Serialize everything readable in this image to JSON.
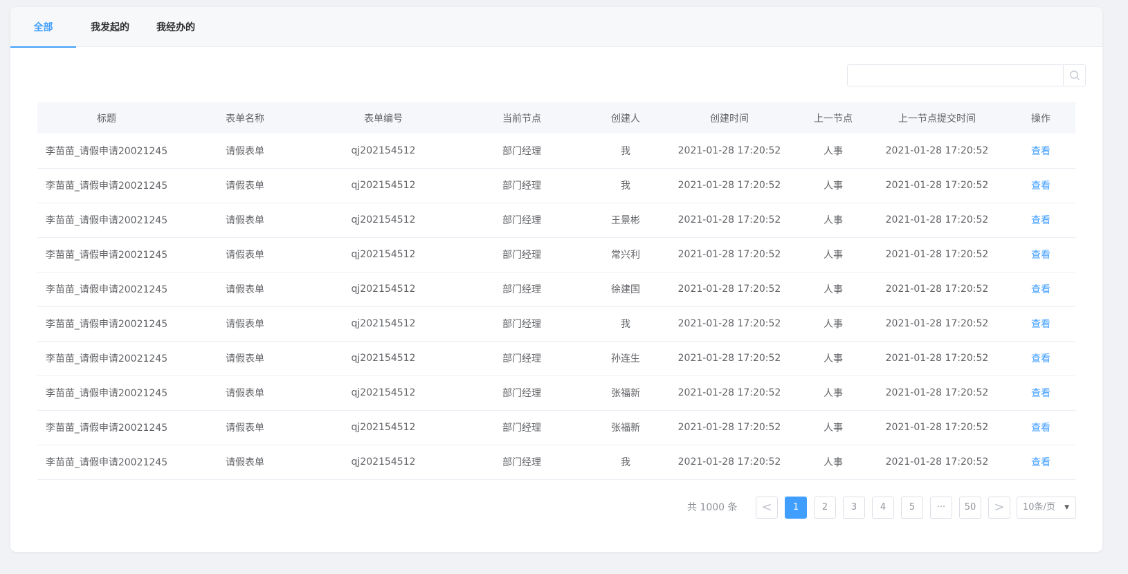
{
  "tabs": [
    {
      "label": "全部",
      "active": true
    },
    {
      "label": "我发起的",
      "active": false
    },
    {
      "label": "我经办的",
      "active": false
    }
  ],
  "search": {
    "placeholder": "",
    "value": "",
    "icon": "search-icon"
  },
  "table": {
    "columns": [
      "标题",
      "表单名称",
      "表单编号",
      "当前节点",
      "创建人",
      "创建时间",
      "上一节点",
      "上一节点提交时间",
      "操作"
    ],
    "rows": [
      {
        "title": "李苗苗_请假申请20021245",
        "form_name": "请假表单",
        "form_no": "qj202154512",
        "current_node": "部门经理",
        "creator": "我",
        "created_at": "2021-01-28 17:20:52",
        "prev_node": "人事",
        "prev_submit_at": "2021-01-28 17:20:52",
        "action": "查看"
      },
      {
        "title": "李苗苗_请假申请20021245",
        "form_name": "请假表单",
        "form_no": "qj202154512",
        "current_node": "部门经理",
        "creator": "我",
        "created_at": "2021-01-28 17:20:52",
        "prev_node": "人事",
        "prev_submit_at": "2021-01-28 17:20:52",
        "action": "查看"
      },
      {
        "title": "李苗苗_请假申请20021245",
        "form_name": "请假表单",
        "form_no": "qj202154512",
        "current_node": "部门经理",
        "creator": "王景彬",
        "created_at": "2021-01-28 17:20:52",
        "prev_node": "人事",
        "prev_submit_at": "2021-01-28 17:20:52",
        "action": "查看"
      },
      {
        "title": "李苗苗_请假申请20021245",
        "form_name": "请假表单",
        "form_no": "qj202154512",
        "current_node": "部门经理",
        "creator": "常兴利",
        "created_at": "2021-01-28 17:20:52",
        "prev_node": "人事",
        "prev_submit_at": "2021-01-28 17:20:52",
        "action": "查看"
      },
      {
        "title": "李苗苗_请假申请20021245",
        "form_name": "请假表单",
        "form_no": "qj202154512",
        "current_node": "部门经理",
        "creator": "徐建国",
        "created_at": "2021-01-28 17:20:52",
        "prev_node": "人事",
        "prev_submit_at": "2021-01-28 17:20:52",
        "action": "查看"
      },
      {
        "title": "李苗苗_请假申请20021245",
        "form_name": "请假表单",
        "form_no": "qj202154512",
        "current_node": "部门经理",
        "creator": "我",
        "created_at": "2021-01-28 17:20:52",
        "prev_node": "人事",
        "prev_submit_at": "2021-01-28 17:20:52",
        "action": "查看"
      },
      {
        "title": "李苗苗_请假申请20021245",
        "form_name": "请假表单",
        "form_no": "qj202154512",
        "current_node": "部门经理",
        "creator": "孙连生",
        "created_at": "2021-01-28 17:20:52",
        "prev_node": "人事",
        "prev_submit_at": "2021-01-28 17:20:52",
        "action": "查看"
      },
      {
        "title": "李苗苗_请假申请20021245",
        "form_name": "请假表单",
        "form_no": "qj202154512",
        "current_node": "部门经理",
        "creator": "张福新",
        "created_at": "2021-01-28 17:20:52",
        "prev_node": "人事",
        "prev_submit_at": "2021-01-28 17:20:52",
        "action": "查看"
      },
      {
        "title": "李苗苗_请假申请20021245",
        "form_name": "请假表单",
        "form_no": "qj202154512",
        "current_node": "部门经理",
        "creator": "张福新",
        "created_at": "2021-01-28 17:20:52",
        "prev_node": "人事",
        "prev_submit_at": "2021-01-28 17:20:52",
        "action": "查看"
      },
      {
        "title": "李苗苗_请假申请20021245",
        "form_name": "请假表单",
        "form_no": "qj202154512",
        "current_node": "部门经理",
        "creator": "我",
        "created_at": "2021-01-28 17:20:52",
        "prev_node": "人事",
        "prev_submit_at": "2021-01-28 17:20:52",
        "action": "查看"
      }
    ]
  },
  "pagination": {
    "total_text": "共 1000 条",
    "prev": "<",
    "next": ">",
    "pages": [
      "1",
      "2",
      "3",
      "4",
      "5",
      "···",
      "50"
    ],
    "current": "1",
    "page_size": "10条/页"
  },
  "colors": {
    "accent": "#409eff",
    "text": "#606266",
    "muted": "#909399",
    "border": "#ebeef5"
  }
}
